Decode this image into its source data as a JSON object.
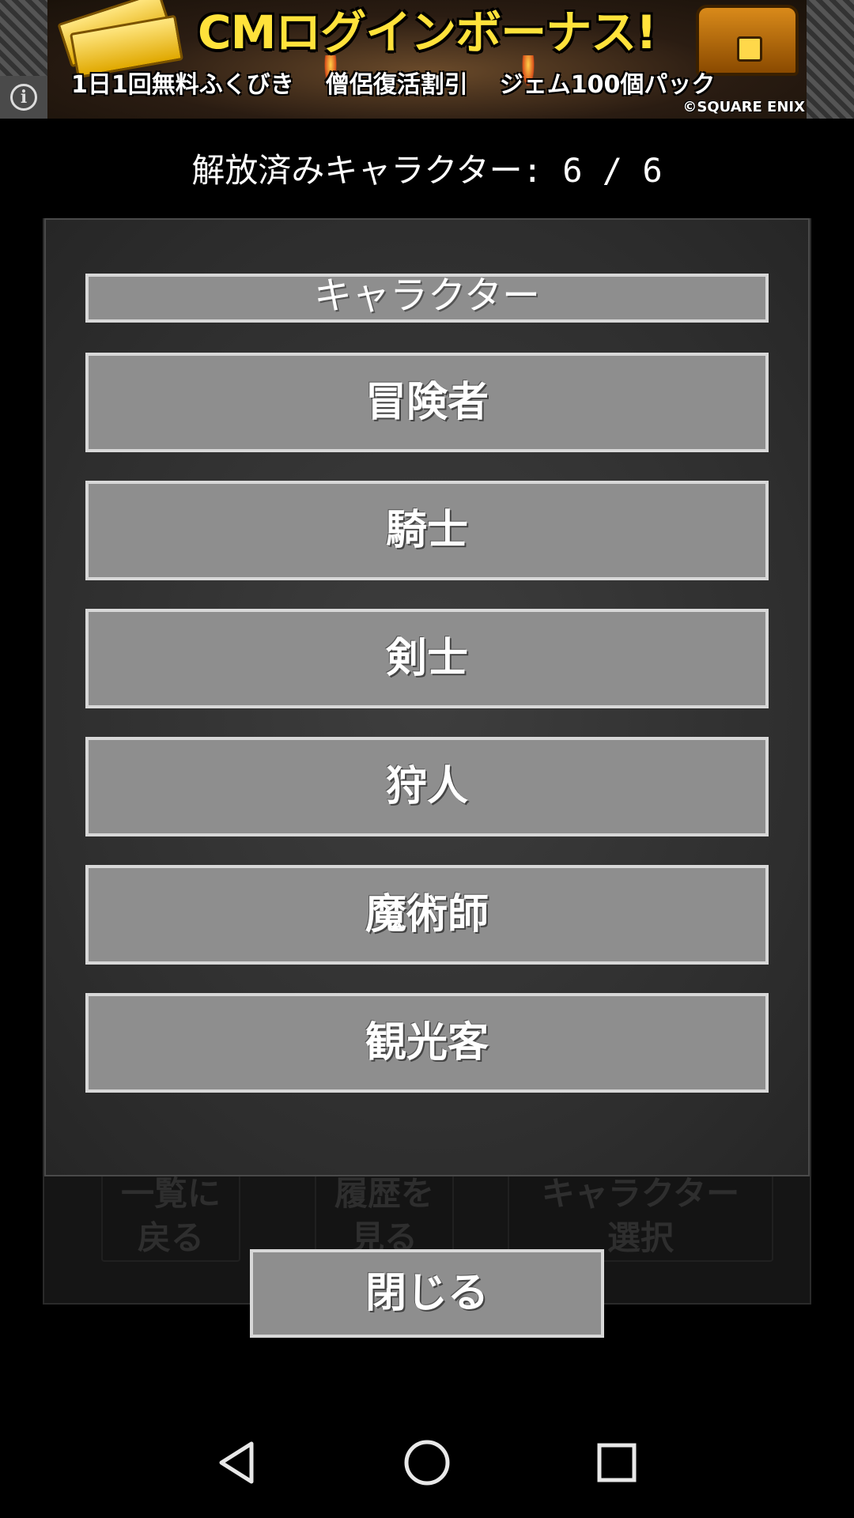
{
  "ad": {
    "title": "CMログインボーナス!",
    "subtitles": [
      "1日1回無料ふくびき",
      "僧侶復活割引",
      "ジェム100個パック"
    ],
    "copyright": "©SQUARE ENIX",
    "info_icon": "info-icon"
  },
  "header": {
    "unlocked_text": "解放済みキャラクター: 6 / 6"
  },
  "background_buttons": {
    "back_line1": "一覧に",
    "back_line2": "戻る",
    "history_line1": "履歴を",
    "history_line2": "見る",
    "select_line1": "キャラクター",
    "select_line2": "選択"
  },
  "dialog": {
    "title": "キャラクター",
    "characters": [
      "冒険者",
      "騎士",
      "剣士",
      "狩人",
      "魔術師",
      "観光客"
    ],
    "close_label": "閉じる"
  },
  "navbar": {
    "back_icon": "back-triangle-icon",
    "home_icon": "home-circle-icon",
    "recent_icon": "recent-square-icon"
  }
}
